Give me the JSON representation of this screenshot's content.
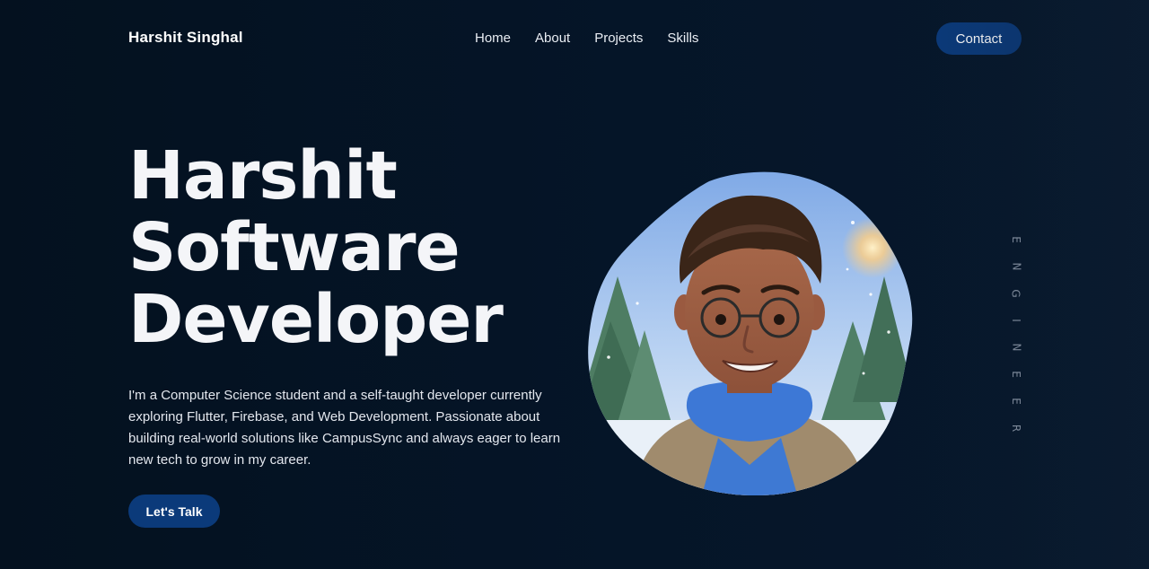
{
  "nav": {
    "brand": "Harshit Singhal",
    "links": [
      "Home",
      "About",
      "Projects",
      "Skills"
    ],
    "contact_label": "Contact"
  },
  "hero": {
    "title_lines": [
      "Harshit",
      "Software",
      "Developer"
    ],
    "description": "I'm a Computer Science student and a self-taught developer currently exploring Flutter, Firebase, and Web Development. Passionate about building real-world solutions like CampusSync and always eager to learn new tech to grow in my career.",
    "cta_label": "Let's Talk"
  },
  "side": {
    "letters": [
      "E",
      "N",
      "G",
      "I",
      "N",
      "E",
      "E",
      "R"
    ]
  },
  "colors": {
    "background": "#051426",
    "button": "#0b3a7a",
    "text": "#ffffff"
  },
  "icons": {
    "portrait": "avatar-portrait"
  }
}
